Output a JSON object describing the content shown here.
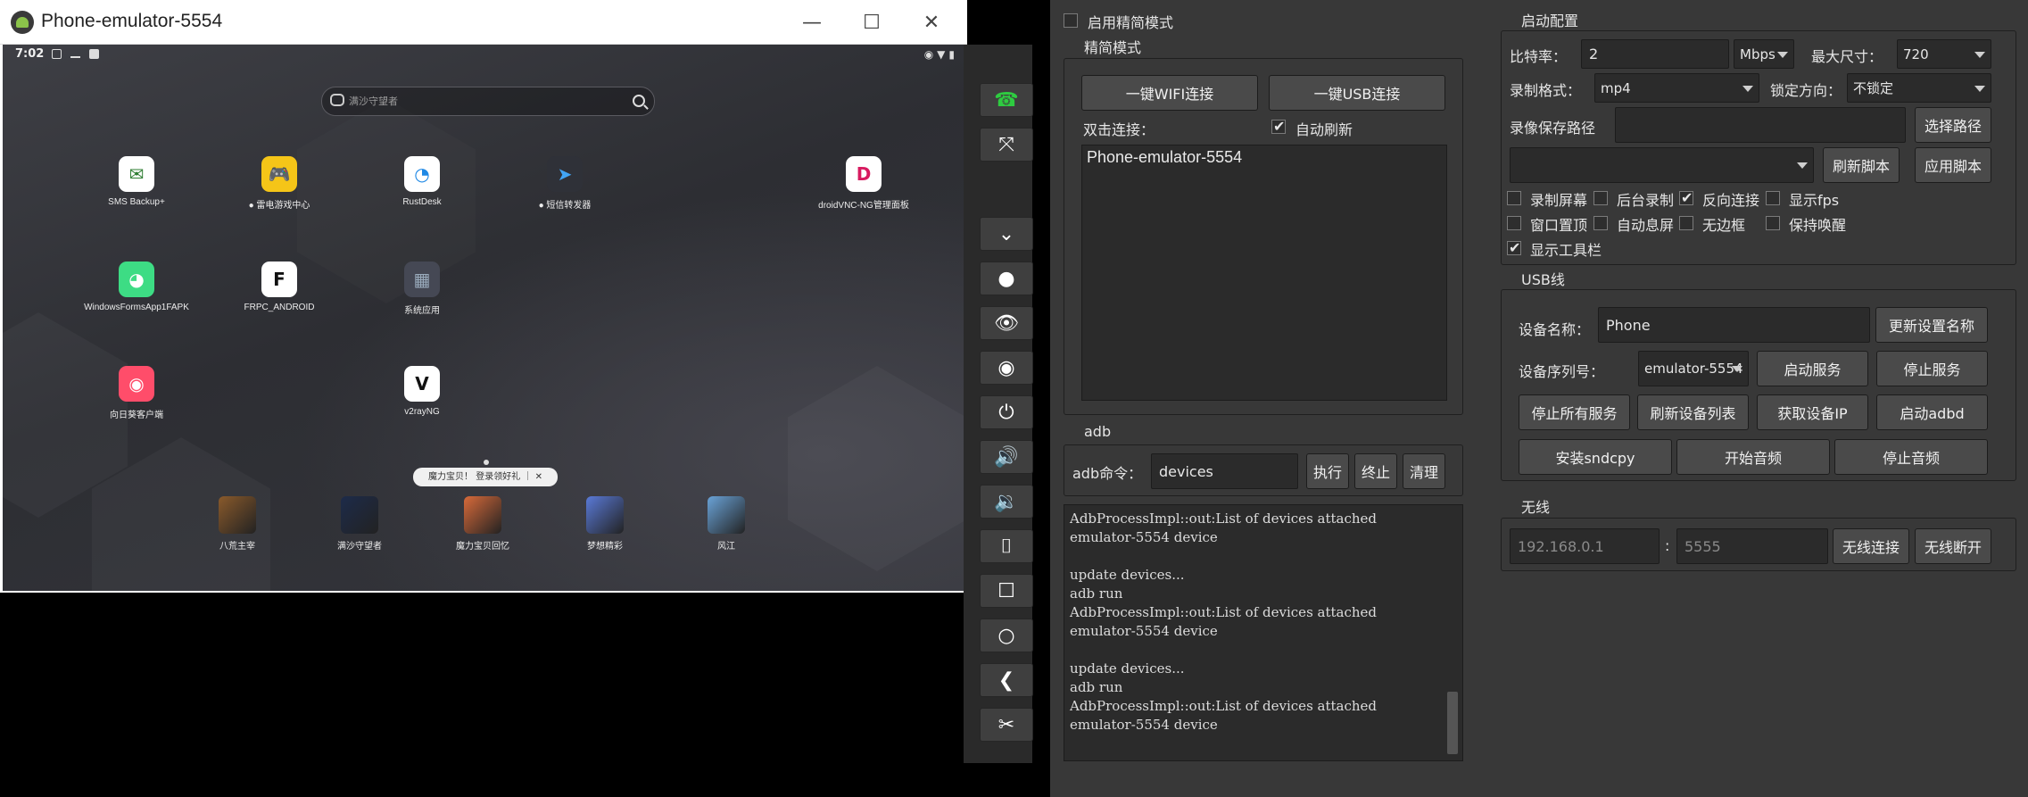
{
  "emulator": {
    "window_title": "Phone-emulator-5554",
    "window_controls": [
      "—",
      "☐",
      "✕"
    ],
    "status_time": "7:02",
    "search_placeholder": "满沙守望者",
    "apps": [
      {
        "label": "SMS Backup+",
        "icon": "sms-backup-icon",
        "color": "#ffffff",
        "glyph": "✉",
        "glyph_color": "#2e7d32"
      },
      {
        "label": "● 雷电游戏中心",
        "icon": "game-center-icon",
        "color": "#f5c518",
        "glyph": "🎮",
        "glyph_color": "#222"
      },
      {
        "label": "RustDesk",
        "icon": "rustdesk-icon",
        "color": "#ffffff",
        "glyph": "◔",
        "glyph_color": "#1e88e5"
      },
      {
        "label": "● 短信转发器",
        "icon": "sms-forwarder-icon",
        "color": "#2f3138",
        "glyph": "➤",
        "glyph_color": "#42a5f5"
      },
      {
        "label": "droidVNC-NG管理面板",
        "icon": "droidvnc-icon",
        "color": "#ffffff",
        "glyph": "D",
        "glyph_color": "#d81b60"
      },
      {
        "label": "WindowsFormsApp1FAPK",
        "icon": "android-app-icon",
        "color": "#3ddc84",
        "glyph": "◕",
        "glyph_color": "#ffffff"
      },
      {
        "label": "FRPC_ANDROID",
        "icon": "frpc-icon",
        "color": "#ffffff",
        "glyph": "F",
        "glyph_color": "#111111"
      },
      {
        "label": "系统应用",
        "icon": "system-apps-folder-icon",
        "color": "#454854",
        "glyph": "▦",
        "glyph_color": "#9ab"
      },
      {
        "label": "向日葵客户端",
        "icon": "sunlogin-icon",
        "color": "#ff4d6a",
        "glyph": "◉",
        "glyph_color": "#ffffff"
      },
      {
        "label": "v2rayNG",
        "icon": "v2rayng-icon",
        "color": "#ffffff",
        "glyph": "V",
        "glyph_color": "#111111"
      }
    ],
    "toast": "魔力宝贝！ 登录领好礼 ｜ ✕",
    "dock": [
      {
        "label": "八荒主宰",
        "icon": "game-bahuang-icon",
        "color": "#8a5a2b"
      },
      {
        "label": "满沙守望者",
        "icon": "game-mansha-icon",
        "color": "#1d2b4a"
      },
      {
        "label": "魔力宝贝回忆",
        "icon": "game-moli-icon",
        "color": "#d86a3a"
      },
      {
        "label": "梦想精彩",
        "icon": "game-mengxiang-icon",
        "color": "#5a7ad8"
      },
      {
        "label": "风江",
        "icon": "game-fengjiang-icon",
        "color": "#6aa3d8"
      }
    ]
  },
  "toolbar": {
    "buttons": [
      {
        "name": "group-control-icon",
        "glyph": "☎"
      },
      {
        "name": "fullscreen-icon",
        "glyph": "⤧"
      },
      {
        "name": "collapse-icon",
        "glyph": "⌄"
      },
      {
        "name": "record-dot-icon",
        "glyph": "●"
      },
      {
        "name": "show-icon",
        "glyph": "👁"
      },
      {
        "name": "hide-icon",
        "glyph": "◉"
      },
      {
        "name": "power-icon",
        "glyph": "⏻"
      },
      {
        "name": "volume-up-icon",
        "glyph": "🔊"
      },
      {
        "name": "volume-down-icon",
        "glyph": "🔉"
      },
      {
        "name": "app-switch-icon",
        "glyph": "⌷"
      },
      {
        "name": "home-square-icon",
        "glyph": "☐"
      },
      {
        "name": "home-circle-icon",
        "glyph": "○"
      },
      {
        "name": "back-icon",
        "glyph": "❮"
      },
      {
        "name": "scissors-icon",
        "glyph": "✂"
      }
    ]
  },
  "simple": {
    "enable_label": "启用精简模式",
    "group_title": "精简模式",
    "wifi_button": "一键WIFI连接",
    "usb_button": "一键USB连接",
    "double_click_label": "双击连接：",
    "auto_refresh_label": "自动刷新",
    "devices": [
      "Phone-emulator-5554"
    ]
  },
  "adb": {
    "group_title": "adb",
    "command_label": "adb命令：",
    "command_value": "devices",
    "execute_button": "执行",
    "stop_button": "终止",
    "clear_button": "清理",
    "log": "AdbProcessImpl::out:List of devices attached\nemulator-5554 device\n\nupdate devices...\nadb run\nAdbProcessImpl::out:List of devices attached\nemulator-5554 device\n\nupdate devices...\nadb run\nAdbProcessImpl::out:List of devices attached\nemulator-5554 device"
  },
  "config": {
    "group_title": "启动配置",
    "bitrate_label": "比特率：",
    "bitrate_value": "2",
    "bitrate_unit": "Mbps",
    "max_size_label": "最大尺寸：",
    "max_size_value": "720",
    "record_format_label": "录制格式：",
    "record_format_value": "mp4",
    "lock_orientation_label": "锁定方向：",
    "lock_orientation_value": "不锁定",
    "record_path_label": "录像保存路径",
    "record_path_value": "",
    "select_path_button": "选择路径",
    "script_value": "",
    "refresh_script_button": "刷新脚本",
    "apply_script_button": "应用脚本",
    "checkboxes": [
      {
        "label": "录制屏幕",
        "checked": false
      },
      {
        "label": "后台录制",
        "checked": false
      },
      {
        "label": "反向连接",
        "checked": true
      },
      {
        "label": "显示fps",
        "checked": false
      },
      {
        "label": "窗口置顶",
        "checked": false
      },
      {
        "label": "自动息屏",
        "checked": false
      },
      {
        "label": "无边框",
        "checked": false
      },
      {
        "label": "保持唤醒",
        "checked": false
      },
      {
        "label": "显示工具栏",
        "checked": true
      }
    ]
  },
  "usb": {
    "group_title": "USB线",
    "device_name_label": "设备名称：",
    "device_name_value": "Phone",
    "update_name_button": "更新设置名称",
    "serial_label": "设备序列号：",
    "serial_value": "emulator-5554",
    "start_service_button": "启动服务",
    "stop_service_button": "停止服务",
    "stop_all_button": "停止所有服务",
    "refresh_devices_button": "刷新设备列表",
    "get_ip_button": "获取设备IP",
    "start_adbd_button": "启动adbd",
    "install_sndcpy_button": "安装sndcpy",
    "start_audio_button": "开始音频",
    "stop_audio_button": "停止音频"
  },
  "wireless": {
    "group_title": "无线",
    "ip_placeholder": "192.168.0.1",
    "colon": ":",
    "port_placeholder": "5555",
    "connect_button": "无线连接",
    "disconnect_button": "无线断开"
  }
}
